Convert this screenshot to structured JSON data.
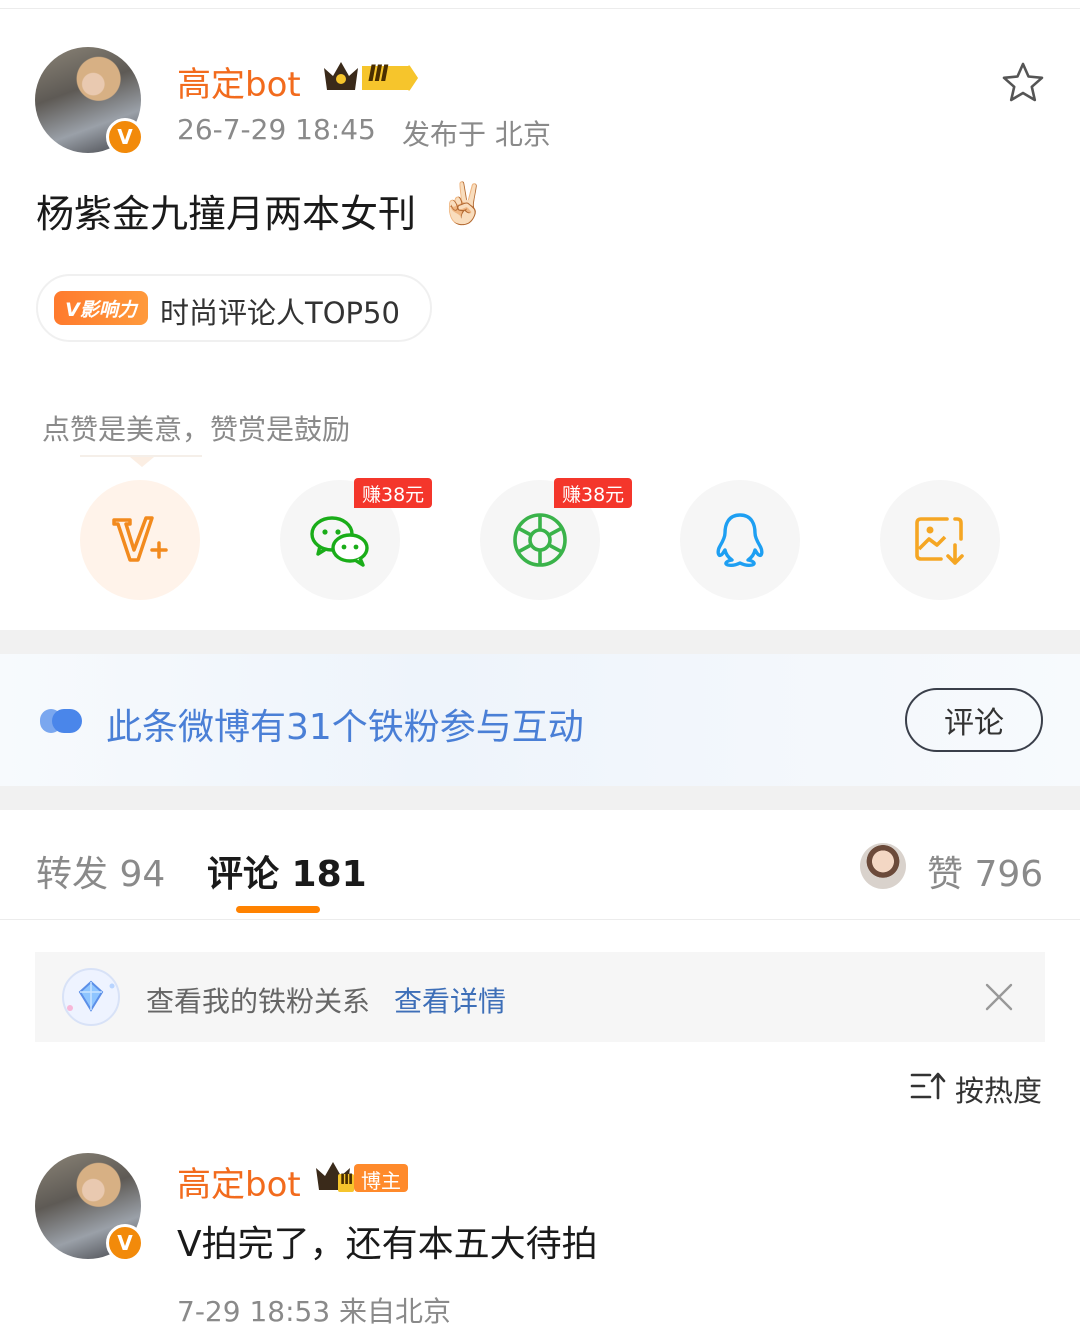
{
  "post": {
    "author": "高定bot",
    "level_badge": "Ⅲ",
    "verified_badge": "V",
    "time": "26-7-29 18:45",
    "location": "发布于 北京",
    "text": "杨紫金九撞月两本女刊",
    "emoji": "✌🏻",
    "influence_badge": "V影响力",
    "influence_text": "时尚评论人TOP50"
  },
  "share": {
    "hint": "点赞是美意，赞赏是鼓励",
    "earn_wechat": "赚38元",
    "earn_moments": "赚38元"
  },
  "banner": {
    "text": "此条微博有31个铁粉参与互动",
    "button": "评论"
  },
  "tabs": {
    "repost": "转发 94",
    "comment": "评论 181",
    "like": "赞 796"
  },
  "fan_notice": {
    "text": "查看我的铁粉关系",
    "link": "查看详情"
  },
  "sort": {
    "label": "按热度"
  },
  "comment": {
    "author": "高定bot",
    "author_tag": "博主",
    "level_badge": "Ⅲ",
    "text": "V拍完了，还有本五大待拍",
    "time": "7-29 18:53 来自北京"
  },
  "colors": {
    "accent_orange": "#f26b1d",
    "link_blue": "#3e6fb8",
    "earn_red": "#f4362b",
    "wechat_green": "#1aad19"
  }
}
